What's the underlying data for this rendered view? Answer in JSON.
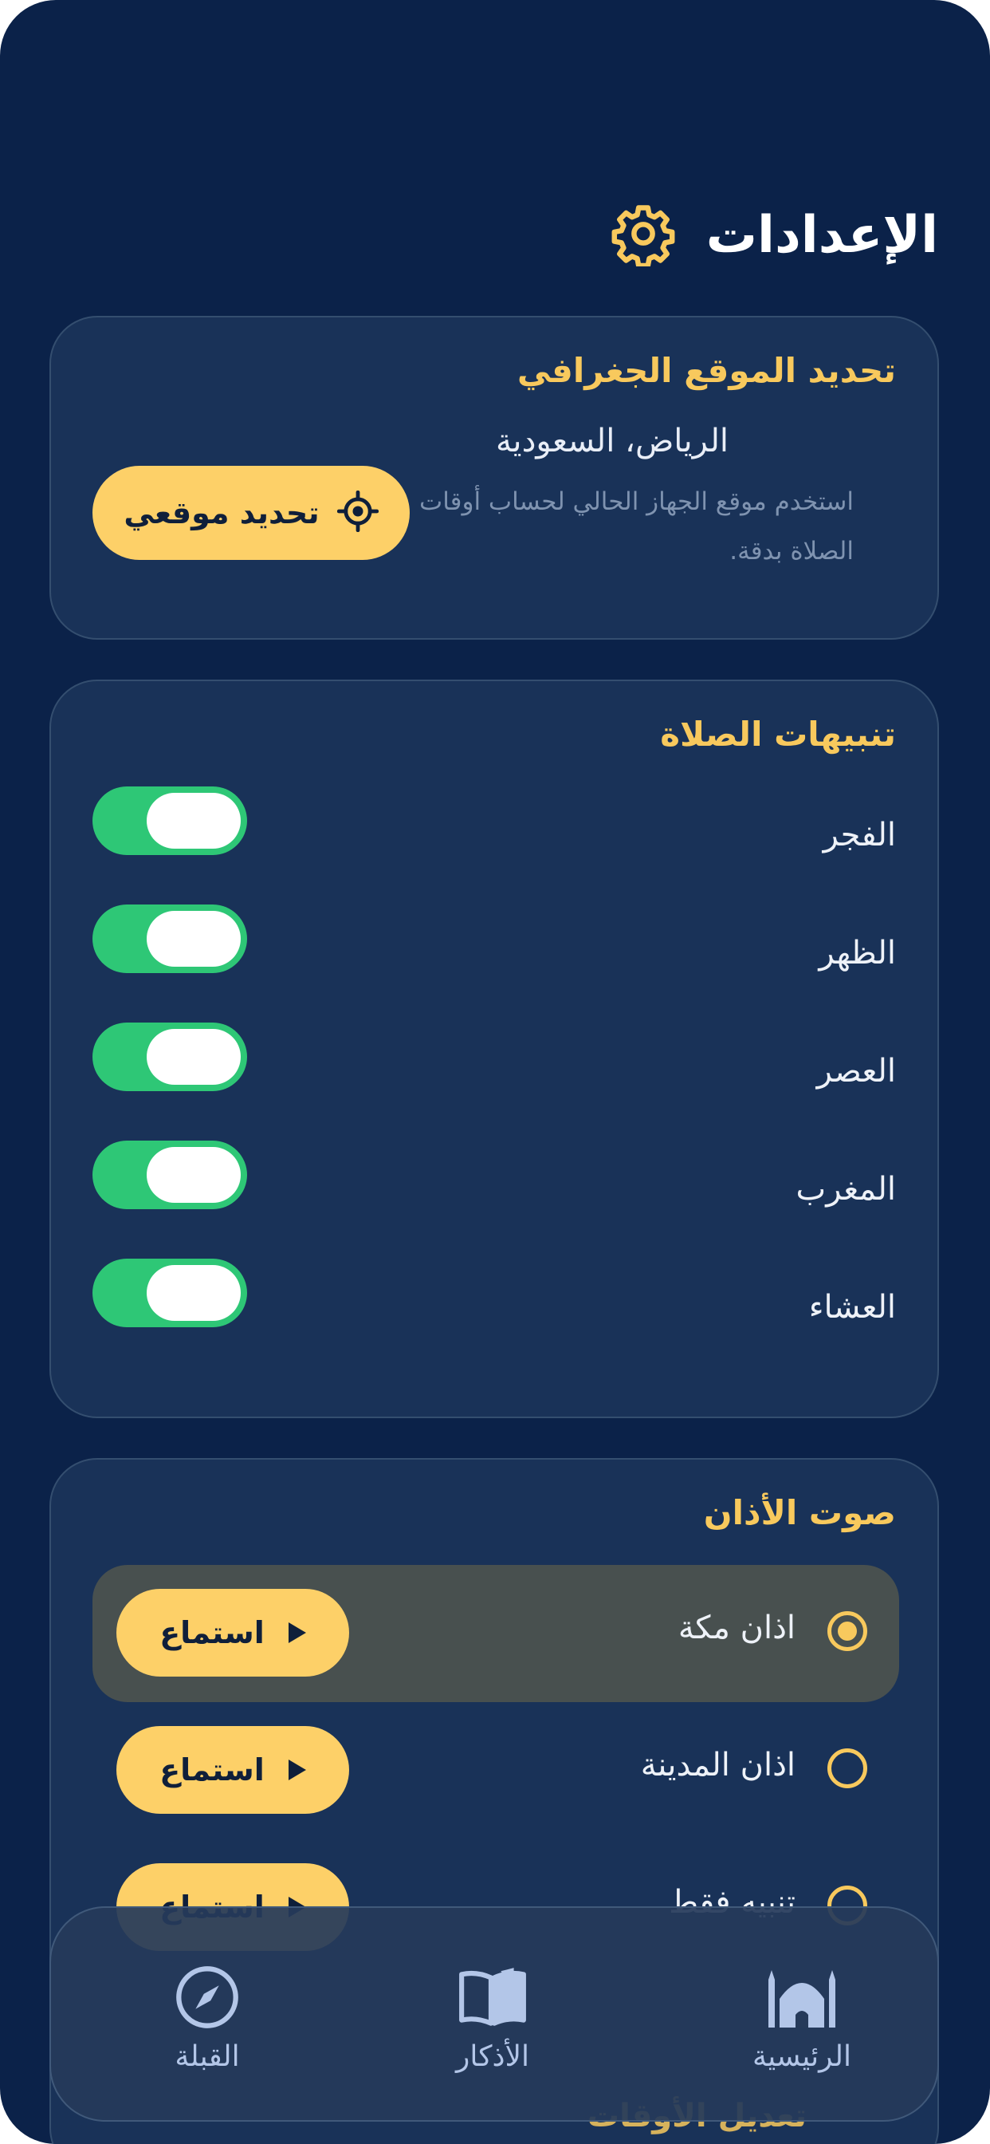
{
  "header": {
    "title": "الإعدادات",
    "icon": "gear-icon"
  },
  "location": {
    "title": "تحديد الموقع الجغرافي",
    "city": "الرياض، السعودية",
    "description": "استخدم موقع الجهاز الحالي لحساب أوقات الصلاة بدقة.",
    "button_label": "تحديد موقعي",
    "button_icon": "locate-target-icon"
  },
  "alerts": {
    "title": "تنبيهات الصلاة",
    "items": [
      {
        "label": "الفجر",
        "enabled": true
      },
      {
        "label": "الظهر",
        "enabled": true
      },
      {
        "label": "العصر",
        "enabled": true
      },
      {
        "label": "المغرب",
        "enabled": true
      },
      {
        "label": "العشاء",
        "enabled": true
      }
    ]
  },
  "adhan": {
    "title": "صوت الأذان",
    "options": [
      {
        "label": "اذان مكة",
        "selected": true,
        "button": "استماع"
      },
      {
        "label": "اذان المدينة",
        "selected": false,
        "button": "استماع"
      },
      {
        "label": "تنبيه فقط",
        "selected": false,
        "button": "استماع"
      }
    ]
  },
  "next_section_peek": "تعديل الأوقات",
  "nav": {
    "items": [
      {
        "label": "الرئيسية",
        "icon": "mosque-icon",
        "active": true
      },
      {
        "label": "الأذكار",
        "icon": "open-book-icon",
        "active": false
      },
      {
        "label": "القبلة",
        "icon": "compass-icon",
        "active": false
      }
    ]
  },
  "colors": {
    "background": "#0b2249",
    "card": "#193258",
    "accent": "#f8c95d",
    "button": "#fdd068",
    "toggle_on": "#2ec776"
  }
}
